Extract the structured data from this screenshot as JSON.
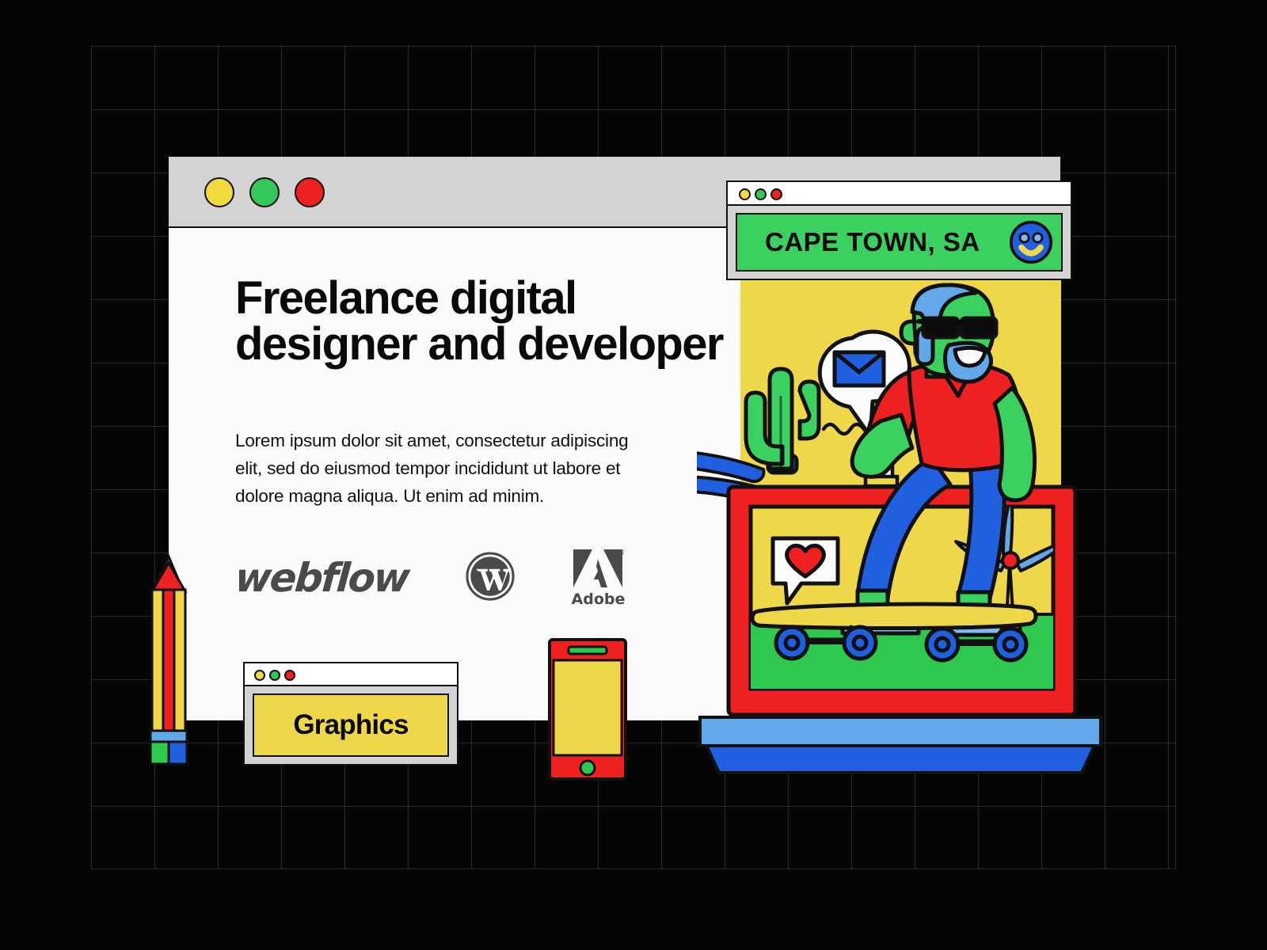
{
  "page": {
    "background_color": "#050505",
    "grid_color": "rgba(255,255,255,0.14)"
  },
  "main_window": {
    "name": "main-browser-window",
    "traffic_lights": [
      {
        "name": "yellow",
        "color": "#f0da3e"
      },
      {
        "name": "green",
        "color": "#34c759"
      },
      {
        "name": "red",
        "color": "#ef2020"
      }
    ],
    "headline": "Freelance digital designer and developer",
    "body_copy": "Lorem ipsum dolor sit amet, consectetur adipiscing elit, sed do eiusmod tempor incididunt ut labore et dolore magna aliqua. Ut enim ad minim.",
    "logos": [
      {
        "name": "webflow-logo",
        "label": "webflow"
      },
      {
        "name": "wordpress-logo",
        "label": "W"
      },
      {
        "name": "adobe-logo",
        "label": "Adobe",
        "mark": "A",
        "trademark": "®"
      }
    ]
  },
  "cape_window": {
    "name": "cape-town-window",
    "traffic_lights": [
      {
        "name": "yellow",
        "color": "#f0da3e"
      },
      {
        "name": "green",
        "color": "#34c759"
      },
      {
        "name": "red",
        "color": "#ef2020"
      }
    ],
    "location_label": "CAPE TOWN, SA",
    "bar_color": "#3ad160",
    "smiley_icon": "smiley-face-icon"
  },
  "graphics_window": {
    "name": "graphics-window",
    "traffic_lights": [
      {
        "name": "yellow",
        "color": "#f0da3e"
      },
      {
        "name": "green",
        "color": "#34c759"
      },
      {
        "name": "red",
        "color": "#ef2020"
      }
    ],
    "chip_label": "Graphics",
    "chip_color": "#eed84a"
  },
  "illustration": {
    "name": "skateboarder-scene",
    "backdrop_color": "#eed84a",
    "laptop_frame_color": "#ef2020",
    "laptop_base_color": "#1f5fe0",
    "ground_color": "#2dc84d",
    "elements": [
      {
        "name": "cactus-icon",
        "color": "#3ad160"
      },
      {
        "name": "email-bubble-icon",
        "color": "#1f5fe0"
      },
      {
        "name": "heart-bubble-icon",
        "color": "#ef2020"
      },
      {
        "name": "wind-turbine-icon",
        "color": "#63a8e8"
      },
      {
        "name": "coffee-cup-icon",
        "color": "#eed84a"
      },
      {
        "name": "skateboard-icon",
        "color": "#eed84a"
      },
      {
        "name": "speed-lines-icon",
        "color": "#1f5fe0"
      }
    ],
    "character": {
      "name": "skateboarder-character",
      "skin_color": "#3ad160",
      "hair_color": "#63a8e8",
      "shirt_color": "#ef2020",
      "pants_color": "#1f5fe0",
      "shoes_color": "#63a8e8",
      "sunglasses_color": "#0a0a0a"
    }
  },
  "phone": {
    "name": "smartphone-device",
    "body_color": "#ef2020",
    "screen_color": "#eed84a",
    "speaker_color": "#2dc84d",
    "home_button_color": "#2dc84d"
  },
  "pencil": {
    "name": "pencil-icon",
    "barrel_color": "#eed84a",
    "stripe_color": "#ef2020",
    "tip_color": "#ef2020",
    "lead_color": "#63a8e8",
    "ferrule_color": "#63a8e8",
    "eraser_colors": [
      "#2dc84d",
      "#1f5fe0"
    ]
  }
}
